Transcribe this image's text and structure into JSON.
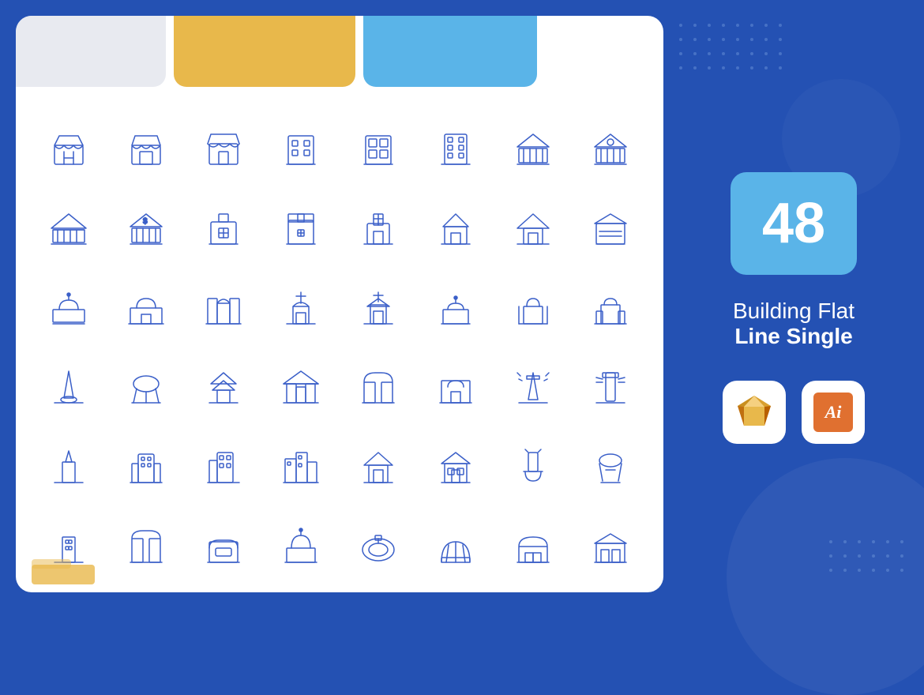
{
  "right_panel": {
    "count": "48",
    "title_line1": "Building Flat",
    "title_line2": "Line Single",
    "sketch_label": "Sketch",
    "illustrator_label": "Ai"
  },
  "decorative": {
    "dot_count": 32,
    "bottom_dot_count": 18
  }
}
